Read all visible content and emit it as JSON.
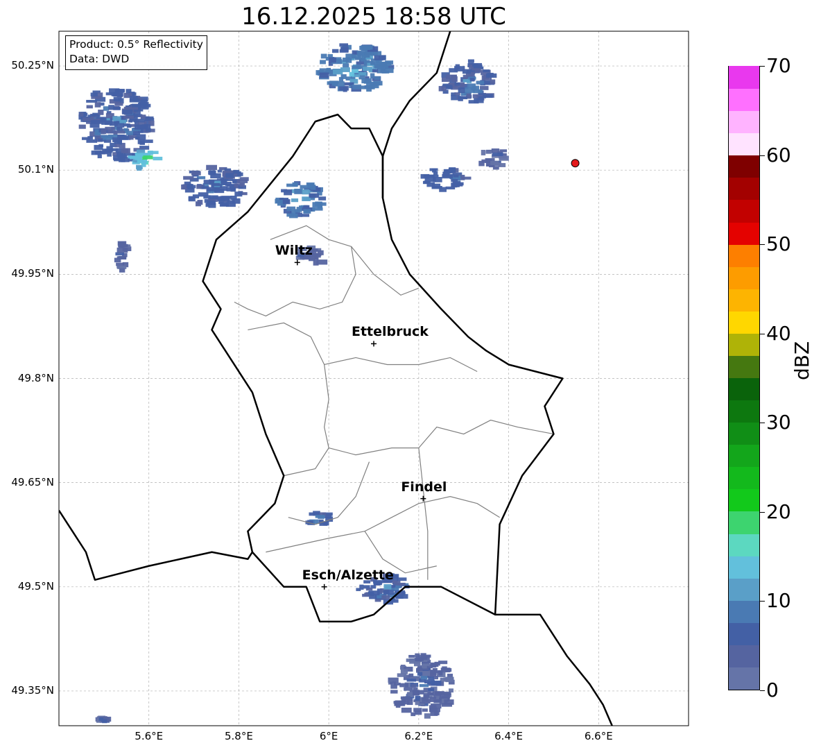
{
  "title": "16.12.2025 18:58 UTC",
  "info_box": {
    "product": "Product: 0.5° Reflectivity",
    "data": "Data: DWD"
  },
  "map": {
    "lon_range": [
      5.4,
      6.8
    ],
    "lat_range": [
      49.3,
      50.3
    ],
    "lat_ticks": [
      {
        "value": 50.25,
        "label": "50.25°N"
      },
      {
        "value": 50.1,
        "label": "50.1°N"
      },
      {
        "value": 49.95,
        "label": "49.95°N"
      },
      {
        "value": 49.8,
        "label": "49.8°N"
      },
      {
        "value": 49.65,
        "label": "49.65°N"
      },
      {
        "value": 49.5,
        "label": "49.5°N"
      },
      {
        "value": 49.35,
        "label": "49.35°N"
      }
    ],
    "lon_ticks": [
      {
        "value": 5.6,
        "label": "5.6°E"
      },
      {
        "value": 5.8,
        "label": "5.8°E"
      },
      {
        "value": 6.0,
        "label": "6°E"
      },
      {
        "value": 6.2,
        "label": "6.2°E"
      },
      {
        "value": 6.4,
        "label": "6.4°E"
      },
      {
        "value": 6.6,
        "label": "6.6°E"
      }
    ],
    "grid": true,
    "cities": [
      {
        "name": "Wiltz",
        "lon": 5.93,
        "lat": 49.967
      },
      {
        "name": "Ettelbruck",
        "lon": 6.1,
        "lat": 49.85
      },
      {
        "name": "Findel",
        "lon": 6.21,
        "lat": 49.627
      },
      {
        "name": "Esch/Alzette",
        "lon": 5.99,
        "lat": 49.5
      }
    ],
    "radar_site": {
      "lon": 6.548,
      "lat": 50.11,
      "color": "#e41a1c"
    },
    "borders": [
      {
        "name": "luxembourg-border",
        "points": [
          [
            5.87,
            50.08
          ],
          [
            5.92,
            50.12
          ],
          [
            5.97,
            50.17
          ],
          [
            6.02,
            50.18
          ],
          [
            6.05,
            50.16
          ],
          [
            6.09,
            50.16
          ],
          [
            6.12,
            50.12
          ],
          [
            6.12,
            50.06
          ],
          [
            6.14,
            50.0
          ],
          [
            6.18,
            49.95
          ],
          [
            6.25,
            49.9
          ],
          [
            6.31,
            49.86
          ],
          [
            6.35,
            49.84
          ],
          [
            6.4,
            49.82
          ],
          [
            6.52,
            49.8
          ],
          [
            6.48,
            49.76
          ],
          [
            6.5,
            49.72
          ],
          [
            6.43,
            49.66
          ],
          [
            6.38,
            49.59
          ],
          [
            6.37,
            49.46
          ],
          [
            6.25,
            49.5
          ],
          [
            6.17,
            49.5
          ],
          [
            6.1,
            49.46
          ],
          [
            6.05,
            49.45
          ],
          [
            5.98,
            49.45
          ],
          [
            5.95,
            49.5
          ],
          [
            5.9,
            49.5
          ],
          [
            5.83,
            49.55
          ],
          [
            5.82,
            49.58
          ],
          [
            5.88,
            49.62
          ],
          [
            5.9,
            49.66
          ],
          [
            5.86,
            49.72
          ],
          [
            5.83,
            49.78
          ],
          [
            5.77,
            49.84
          ],
          [
            5.74,
            49.87
          ],
          [
            5.76,
            49.9
          ],
          [
            5.72,
            49.94
          ],
          [
            5.75,
            50.0
          ],
          [
            5.82,
            50.04
          ],
          [
            5.87,
            50.08
          ]
        ]
      },
      {
        "name": "germany-belgium-border",
        "points": [
          [
            6.12,
            50.06
          ],
          [
            6.12,
            50.12
          ],
          [
            6.14,
            50.16
          ],
          [
            6.18,
            50.2
          ],
          [
            6.24,
            50.24
          ],
          [
            6.27,
            50.3
          ]
        ]
      },
      {
        "name": "france-border",
        "points": [
          [
            5.4,
            49.61
          ],
          [
            5.43,
            49.58
          ],
          [
            5.46,
            49.55
          ],
          [
            5.48,
            49.51
          ],
          [
            5.54,
            49.52
          ],
          [
            5.6,
            49.53
          ],
          [
            5.67,
            49.54
          ],
          [
            5.74,
            49.55
          ],
          [
            5.82,
            49.54
          ],
          [
            5.83,
            49.55
          ]
        ]
      },
      {
        "name": "germany-france-border",
        "points": [
          [
            6.37,
            49.46
          ],
          [
            6.47,
            49.46
          ],
          [
            6.53,
            49.4
          ],
          [
            6.58,
            49.36
          ],
          [
            6.61,
            49.33
          ],
          [
            6.63,
            49.3
          ]
        ]
      }
    ],
    "cantons": [
      {
        "name": "canton-north",
        "points": [
          [
            5.87,
            50.0
          ],
          [
            5.95,
            50.02
          ],
          [
            6.0,
            50.0
          ],
          [
            6.05,
            49.99
          ],
          [
            6.06,
            49.95
          ],
          [
            6.03,
            49.91
          ],
          [
            5.98,
            49.9
          ],
          [
            5.92,
            49.91
          ],
          [
            5.86,
            49.89
          ],
          [
            5.82,
            49.9
          ],
          [
            5.79,
            49.91
          ]
        ]
      },
      {
        "name": "canton-center-n",
        "points": [
          [
            5.82,
            49.87
          ],
          [
            5.9,
            49.88
          ],
          [
            5.96,
            49.86
          ],
          [
            5.99,
            49.82
          ],
          [
            6.06,
            49.83
          ],
          [
            6.13,
            49.82
          ],
          [
            6.2,
            49.82
          ],
          [
            6.27,
            49.83
          ],
          [
            6.33,
            49.81
          ]
        ]
      },
      {
        "name": "canton-center",
        "points": [
          [
            5.99,
            49.82
          ],
          [
            6.0,
            49.77
          ],
          [
            5.99,
            49.73
          ],
          [
            6.0,
            49.7
          ],
          [
            5.97,
            49.67
          ],
          [
            5.9,
            49.66
          ]
        ]
      },
      {
        "name": "canton-center-e",
        "points": [
          [
            6.0,
            49.7
          ],
          [
            6.06,
            49.69
          ],
          [
            6.14,
            49.7
          ],
          [
            6.2,
            49.7
          ],
          [
            6.24,
            49.73
          ],
          [
            6.3,
            49.72
          ],
          [
            6.36,
            49.74
          ],
          [
            6.42,
            49.73
          ],
          [
            6.5,
            49.72
          ]
        ]
      },
      {
        "name": "canton-south",
        "points": [
          [
            5.86,
            49.55
          ],
          [
            5.93,
            49.56
          ],
          [
            6.0,
            49.57
          ],
          [
            6.08,
            49.58
          ],
          [
            6.14,
            49.6
          ],
          [
            6.2,
            49.62
          ],
          [
            6.27,
            49.63
          ],
          [
            6.33,
            49.62
          ],
          [
            6.38,
            49.6
          ]
        ]
      },
      {
        "name": "canton-south-w",
        "points": [
          [
            6.09,
            49.68
          ],
          [
            6.06,
            49.63
          ],
          [
            6.02,
            49.6
          ],
          [
            5.97,
            49.59
          ],
          [
            5.91,
            49.6
          ]
        ]
      },
      {
        "name": "canton-sw",
        "points": [
          [
            6.08,
            49.58
          ],
          [
            6.12,
            49.54
          ],
          [
            6.17,
            49.52
          ],
          [
            6.24,
            49.53
          ]
        ]
      },
      {
        "name": "canton-east",
        "points": [
          [
            6.2,
            49.7
          ],
          [
            6.21,
            49.64
          ],
          [
            6.22,
            49.58
          ],
          [
            6.22,
            49.51
          ]
        ]
      },
      {
        "name": "canton-clervaux",
        "points": [
          [
            6.05,
            49.99
          ],
          [
            6.1,
            49.95
          ],
          [
            6.16,
            49.92
          ],
          [
            6.2,
            49.93
          ]
        ]
      }
    ]
  },
  "colorbar": {
    "label": "dBZ",
    "min": 0,
    "max": 70,
    "ticks": [
      {
        "value": 0,
        "label": "0"
      },
      {
        "value": 10,
        "label": "10"
      },
      {
        "value": 20,
        "label": "20"
      },
      {
        "value": 30,
        "label": "30"
      },
      {
        "value": 40,
        "label": "40"
      },
      {
        "value": 50,
        "label": "50"
      },
      {
        "value": 60,
        "label": "60"
      },
      {
        "value": 70,
        "label": "70"
      }
    ],
    "step": 2.5,
    "colors": [
      "#6574a8",
      "#5564a0",
      "#4360a5",
      "#4a7ab3",
      "#5a9fc8",
      "#62c0dc",
      "#5cd8c0",
      "#3dd46f",
      "#12c91b",
      "#13b91c",
      "#13a61b",
      "#108e16",
      "#0d780f",
      "#0a630b",
      "#457810",
      "#afb307",
      "#ffd700",
      "#fdb401",
      "#fd9c00",
      "#fd7f00",
      "#e40200",
      "#c20100",
      "#a30100",
      "#7f0000",
      "#ffe3ff",
      "#ffb3ff",
      "#ff70ff",
      "#e938ee"
    ]
  },
  "radar_echoes": [
    {
      "name": "echo-nw",
      "lon": 5.52,
      "lat": 50.17,
      "w": 0.16,
      "h": 0.11,
      "level": 2
    },
    {
      "name": "echo-nw-core",
      "lon": 5.58,
      "lat": 50.12,
      "w": 0.06,
      "h": 0.03,
      "level": 5
    },
    {
      "name": "echo-nw-band",
      "lon": 5.74,
      "lat": 50.08,
      "w": 0.14,
      "h": 0.06,
      "level": 2
    },
    {
      "name": "echo-north-band",
      "lon": 5.93,
      "lat": 50.06,
      "w": 0.1,
      "h": 0.05,
      "level": 3
    },
    {
      "name": "echo-n-top",
      "lon": 6.05,
      "lat": 50.25,
      "w": 0.16,
      "h": 0.07,
      "level": 3
    },
    {
      "name": "echo-ne",
      "lon": 6.3,
      "lat": 50.23,
      "w": 0.12,
      "h": 0.06,
      "level": 2
    },
    {
      "name": "echo-ne-2",
      "lon": 6.25,
      "lat": 50.09,
      "w": 0.1,
      "h": 0.03,
      "level": 2
    },
    {
      "name": "echo-ne-3",
      "lon": 6.36,
      "lat": 50.12,
      "w": 0.06,
      "h": 0.03,
      "level": 1
    },
    {
      "name": "echo-wiltz",
      "lon": 5.95,
      "lat": 49.98,
      "w": 0.07,
      "h": 0.025,
      "level": 1
    },
    {
      "name": "echo-west",
      "lon": 5.53,
      "lat": 49.98,
      "w": 0.03,
      "h": 0.05,
      "level": 1
    },
    {
      "name": "echo-sw-small",
      "lon": 5.97,
      "lat": 49.6,
      "w": 0.05,
      "h": 0.02,
      "level": 2
    },
    {
      "name": "echo-esch",
      "lon": 6.12,
      "lat": 49.5,
      "w": 0.12,
      "h": 0.04,
      "level": 2
    },
    {
      "name": "echo-south",
      "lon": 6.2,
      "lat": 49.36,
      "w": 0.14,
      "h": 0.09,
      "level": 1
    },
    {
      "name": "echo-sw-corner",
      "lon": 5.49,
      "lat": 49.31,
      "w": 0.03,
      "h": 0.01,
      "level": 1
    }
  ]
}
